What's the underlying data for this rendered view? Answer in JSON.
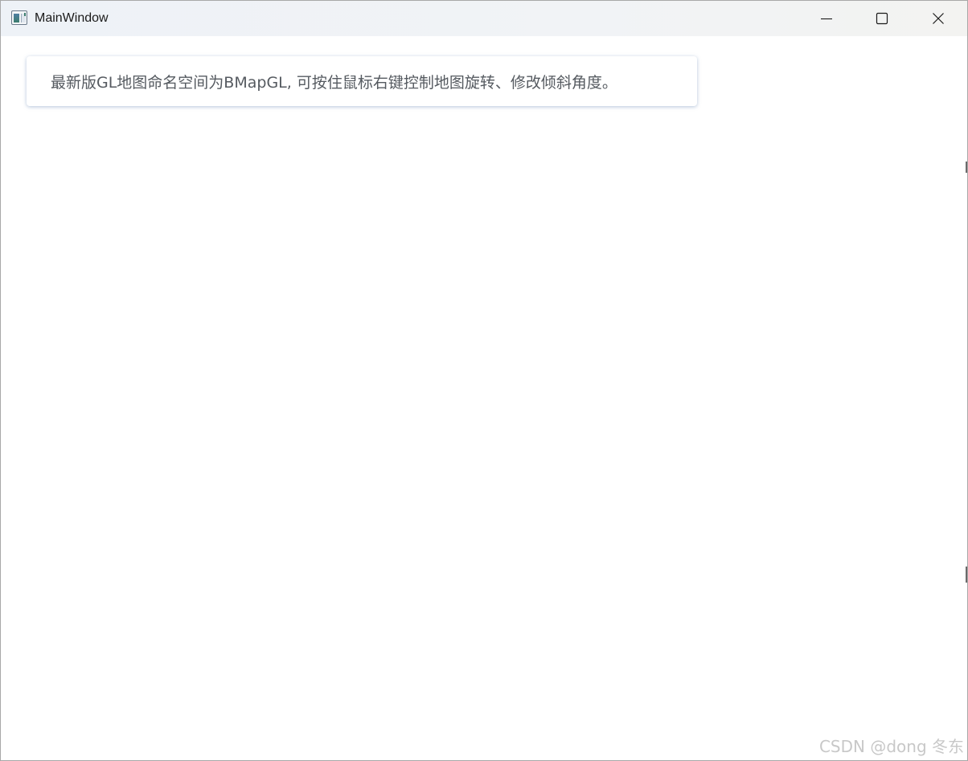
{
  "window": {
    "title": "MainWindow",
    "app_icon": "app-window-icon",
    "controls": {
      "minimize_icon": "minimize-icon",
      "maximize_icon": "maximize-icon",
      "close_icon": "close-icon"
    }
  },
  "main": {
    "info_text": "最新版GL地图命名空间为BMapGL, 可按住鼠标右键控制地图旋转、修改倾斜角度。"
  },
  "watermark": {
    "text": "CSDN @dong 冬东"
  },
  "colors": {
    "titlebar_bg": "#eef2f7",
    "window_bg": "#ffffff",
    "info_text": "#555a60",
    "info_shadow": "#7896be"
  }
}
